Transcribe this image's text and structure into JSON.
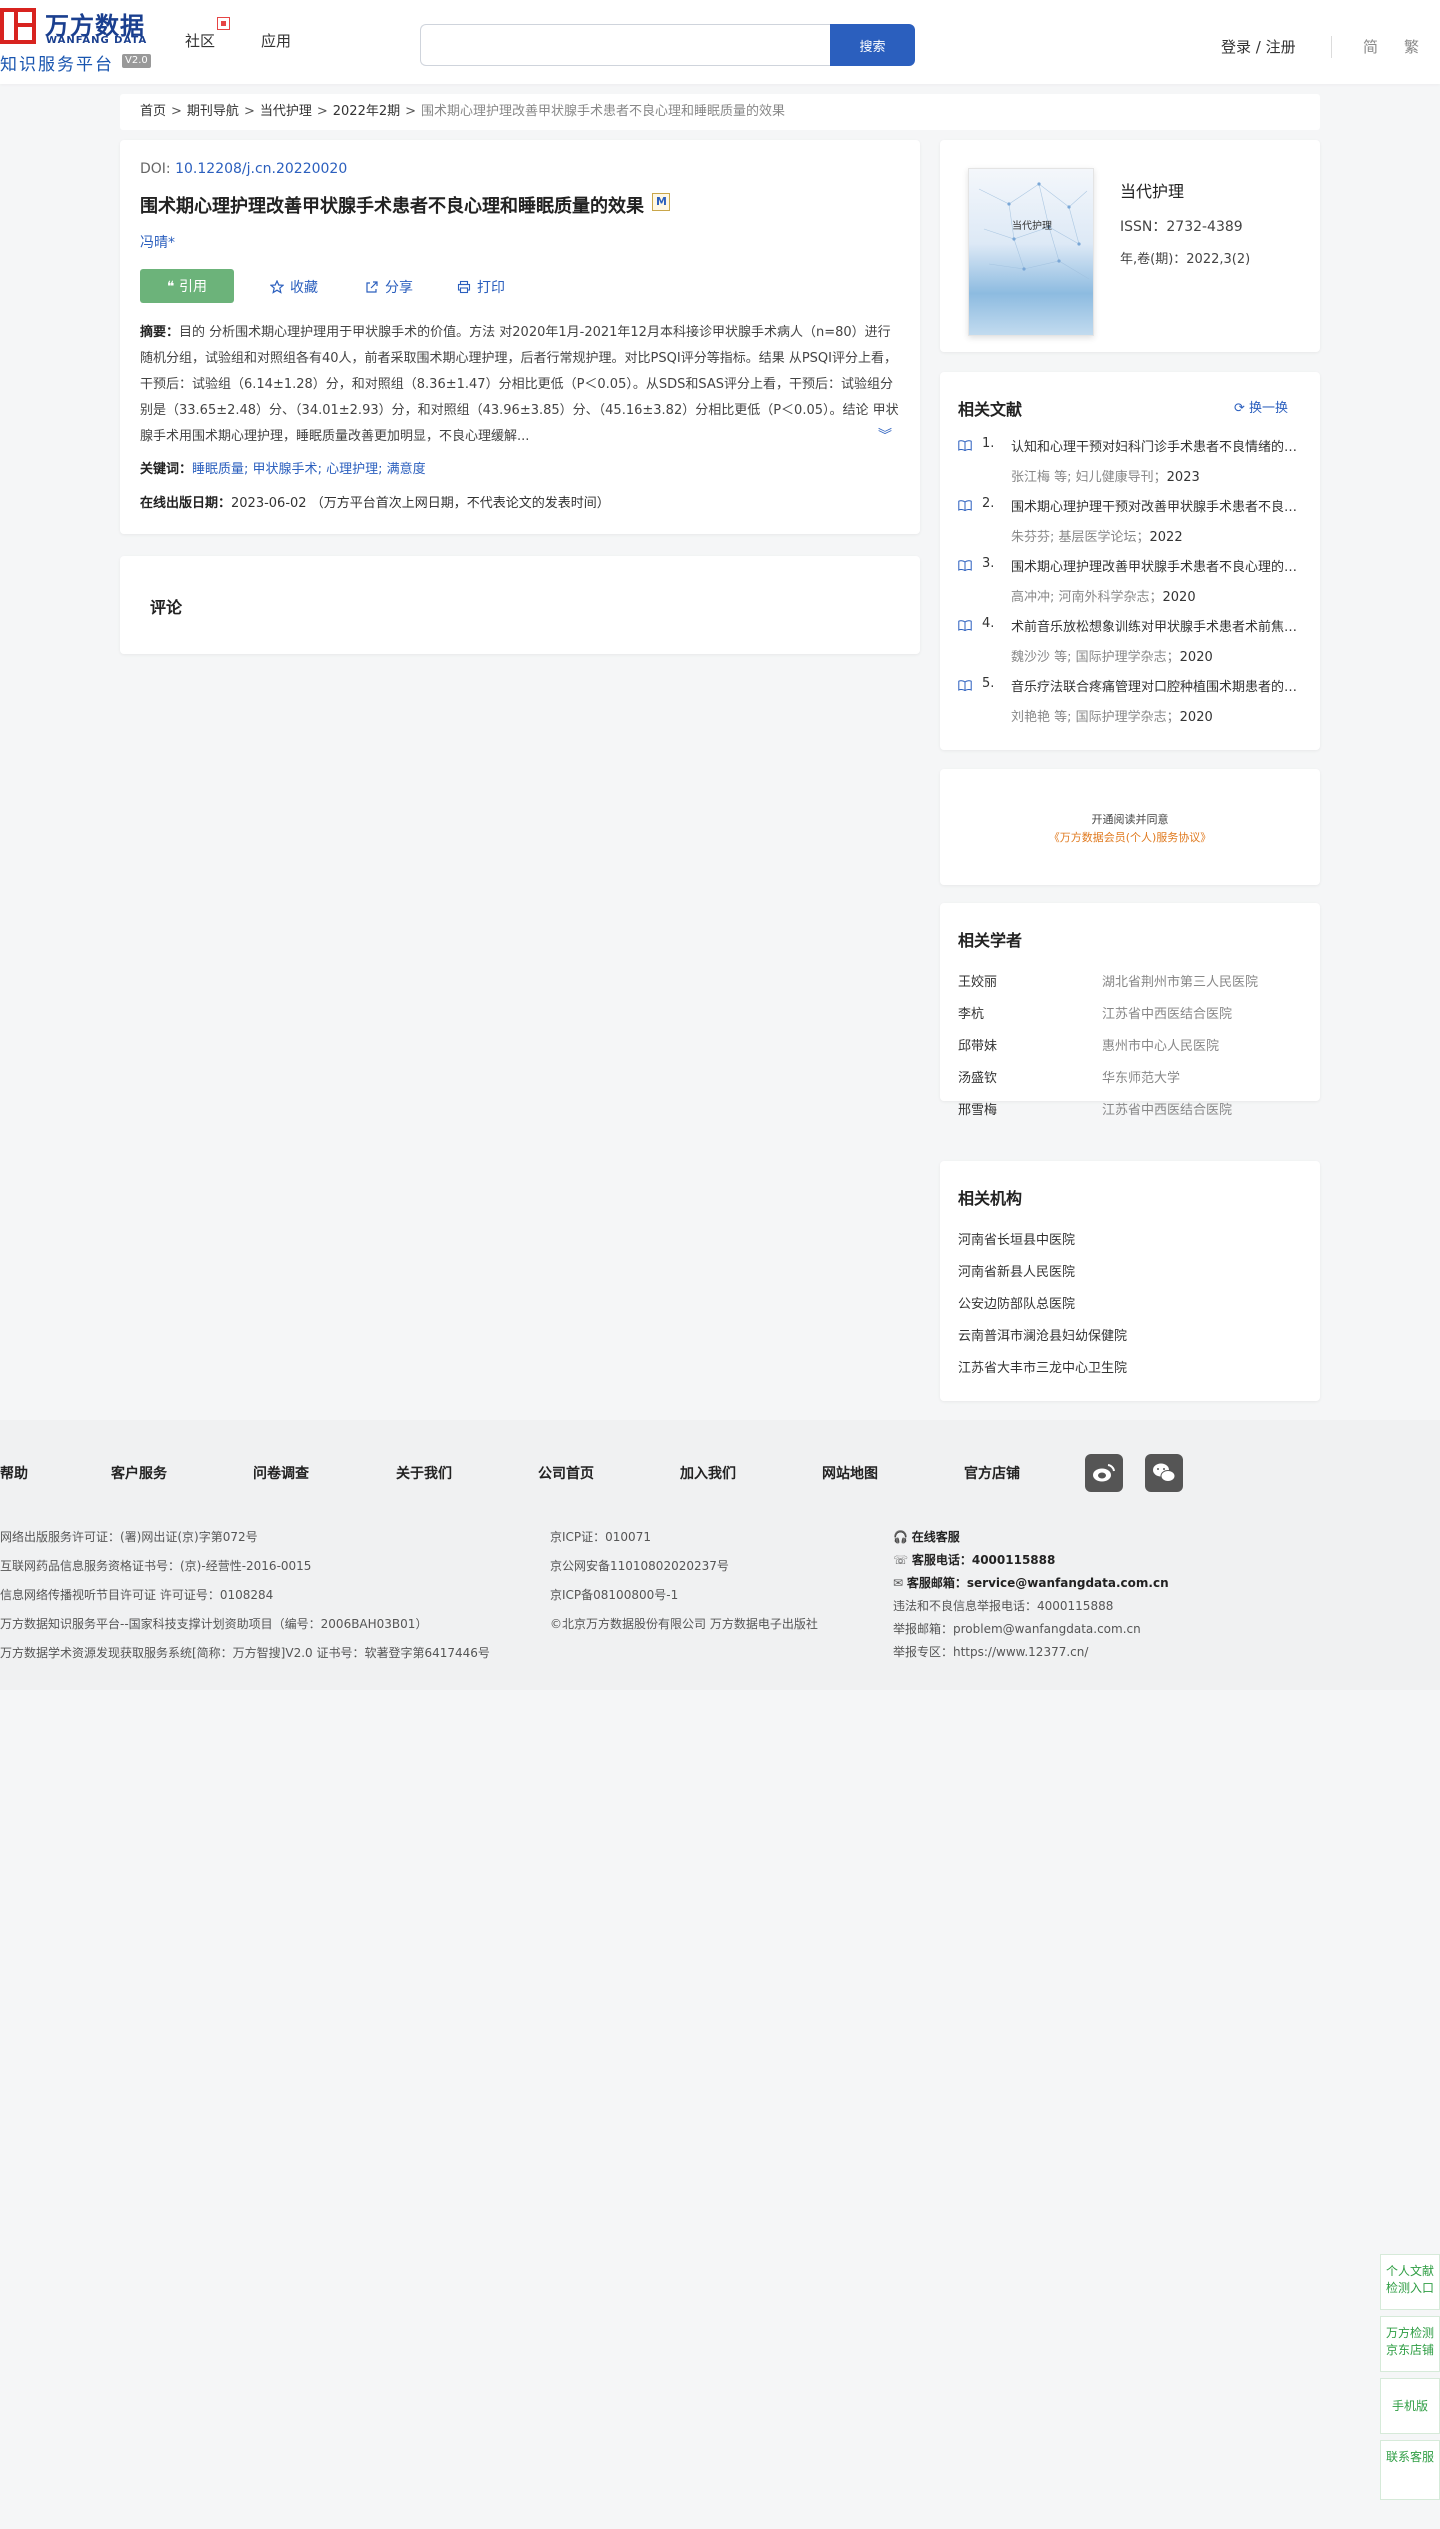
{
  "header": {
    "logo_cn": "万方数据",
    "logo_en": "WANFANG DATA",
    "logo_sub": "知识服务平台",
    "logo_version": "V2.0",
    "nav": [
      "社区",
      "应用"
    ],
    "search_placeholder": "",
    "search_button": "搜索",
    "login": "登录 / 注册",
    "lang_simplified": "简",
    "lang_traditional": "繁"
  },
  "breadcrumb": {
    "items": [
      "首页",
      "期刊导航",
      "当代护理",
      "2022年2期"
    ],
    "current": "围术期心理护理改善甲状腺手术患者不良心理和睡眠质量的效果"
  },
  "article": {
    "doi_label": "DOI:",
    "doi": "10.12208/j.cn.20220020",
    "title": "围术期心理护理改善甲状腺手术患者不良心理和睡眠质量的效果",
    "author": "冯晴*",
    "actions": {
      "cite": "引用",
      "favorite": "收藏",
      "share": "分享",
      "print": "打印"
    },
    "abstract_label": "摘要：",
    "abstract": "目的 分析围术期心理护理用于甲状腺手术的价值。方法 对2020年1月-2021年12月本科接诊甲状腺手术病人（n=80）进行随机分组，试验组和对照组各有40人，前者采取围术期心理护理，后者行常规护理。对比PSQI评分等指标。结果 从PSQI评分上看，干预后：试验组（6.14±1.28）分，和对照组（8.36±1.47）分相比更低（P＜0.05）。从SDS和SAS评分上看，干预后：试验组分别是（33.65±2.48）分、（34.01±2.93）分，和对照组（43.96±3.85）分、（45.16±3.82）分相比更低（P＜0.05）。结论 甲状腺手术用围术期心理护理，睡眠质量改善更加明显，不良心理缓解...",
    "keywords_label": "关键词：",
    "keywords": [
      "睡眠质量",
      "甲状腺手术",
      "心理护理",
      "满意度"
    ],
    "pubdate_label": "在线出版日期：",
    "pubdate": "2023-06-02 （万方平台首次上网日期，不代表论文的发表时间）"
  },
  "comment": {
    "title": "评论"
  },
  "journal": {
    "cover_title": "当代护理",
    "name": "当代护理",
    "issn": "ISSN：2732-4389",
    "volume": "年,卷(期)：2022,3(2)"
  },
  "related_docs": {
    "title": "相关文献",
    "refresh": "换一换",
    "items": [
      {
        "num": "1.",
        "title": "认知和心理干预对妇科门诊手术患者不良情绪的影响",
        "meta": "张江梅 等; 妇儿健康导刊；",
        "year": "2023"
      },
      {
        "num": "2.",
        "title": "围术期心理护理干预对改善甲状腺手术患者不良心理的效果",
        "meta": "朱芬芬; 基层医学论坛；",
        "year": "2022"
      },
      {
        "num": "3.",
        "title": "围术期心理护理改善甲状腺手术患者不良心理的研究",
        "meta": "高冲冲; 河南外科学杂志；",
        "year": "2020"
      },
      {
        "num": "4.",
        "title": "术前音乐放松想象训练对甲状腺手术患者术前焦虑的影响",
        "meta": "魏沙沙 等; 国际护理学杂志；",
        "year": "2020"
      },
      {
        "num": "5.",
        "title": "音乐疗法联合疼痛管理对口腔种植围术期患者的影响",
        "meta": "刘艳艳 等; 国际护理学杂志；",
        "year": "2020"
      }
    ]
  },
  "open_read": {
    "line1": "开通阅读并同意",
    "line2": "《万方数据会员(个人)服务协议》"
  },
  "scholars": {
    "title": "相关学者",
    "items": [
      {
        "name": "王姣丽",
        "org": "湖北省荆州市第三人民医院"
      },
      {
        "name": "李杭",
        "org": "江苏省中西医结合医院"
      },
      {
        "name": "邱带妹",
        "org": "惠州市中心人民医院"
      },
      {
        "name": "汤盛钦",
        "org": "华东师范大学"
      },
      {
        "name": "邢雪梅",
        "org": "江苏省中西医结合医院"
      }
    ]
  },
  "institutions": {
    "title": "相关机构",
    "items": [
      "河南省长垣县中医院",
      "河南省新县人民医院",
      "公安边防部队总医院",
      "云南普洱市澜沧县妇幼保健院",
      "江苏省大丰市三龙中心卫生院"
    ]
  },
  "footer": {
    "nav": [
      "帮助",
      "客户服务",
      "问卷调查",
      "关于我们",
      "公司首页",
      "加入我们",
      "网站地图",
      "官方店铺"
    ],
    "col1": [
      "网络出版服务许可证：(署)网出证(京)字第072号",
      "互联网药品信息服务资格证书号：(京)-经营性-2016-0015",
      "信息网络传播视听节目许可证 许可证号：0108284",
      "万方数据知识服务平台--国家科技支撑计划资助项目（编号：2006BAH03B01）",
      "万方数据学术资源发现获取服务系统[简称：万方智搜]V2.0 证书号：软著登字第6417446号"
    ],
    "col2": [
      "京ICP证：010071",
      "京公网安备11010802020237号",
      "京ICP备08100800号-1",
      "©北京万方数据股份有限公司 万方数据电子出版社"
    ],
    "online_service": "在线客服",
    "phone_label": "客服电话：",
    "phone": "4000115888",
    "email_label": "客服邮箱：",
    "email": "service@wanfangdata.com.cn",
    "report_phone": "违法和不良信息举报电话：4000115888",
    "report_email": "举报邮箱：problem@wanfangdata.com.cn",
    "report_zone": "举报专区：https://www.12377.cn/"
  },
  "side_float": [
    "个人文献检测入口",
    "万方检测京东店铺",
    "手机版",
    "联系客服"
  ],
  "colors": {
    "primary": "#2b5fbe",
    "cite_green": "#6cb37a",
    "logo_red": "#d8231f",
    "agreement_orange": "#e07a1f"
  }
}
